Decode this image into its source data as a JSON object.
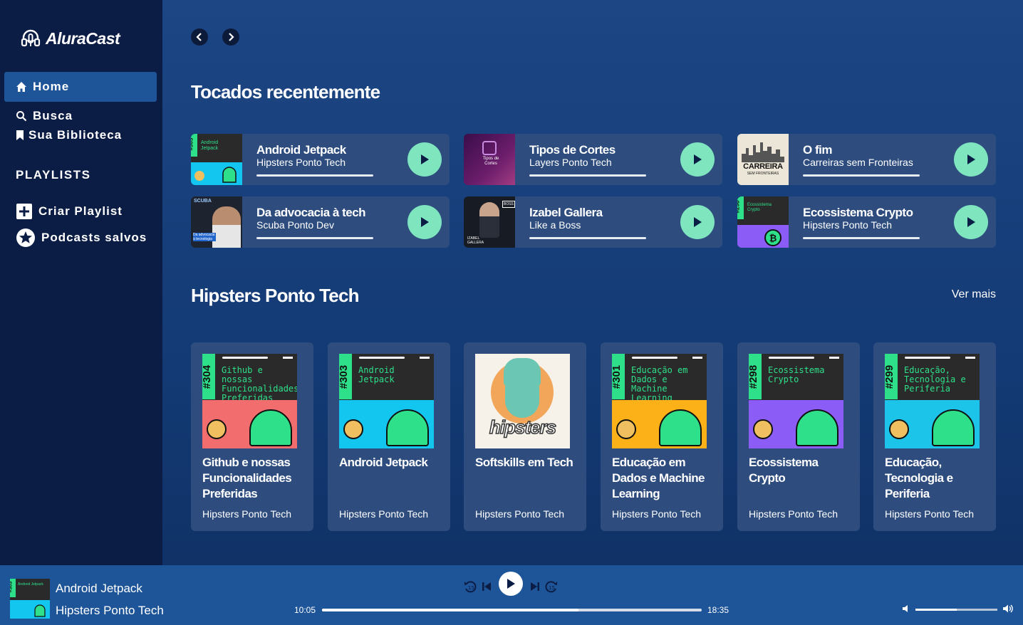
{
  "app": {
    "brand": "AluraCast"
  },
  "sidebar": {
    "nav": [
      {
        "label": "Home",
        "icon": "home-icon"
      },
      {
        "label": "Busca",
        "icon": "search-icon"
      },
      {
        "label": "Sua Biblioteca",
        "icon": "bookmark-icon"
      }
    ],
    "playlists_title": "PLAYLISTS",
    "playlist_items": [
      {
        "label": "Criar Playlist",
        "icon": "plus-square-icon"
      },
      {
        "label": "Podcasts salvos",
        "icon": "star-circle-icon"
      }
    ]
  },
  "recent": {
    "title": "Tocados recentemente",
    "items": [
      {
        "title": "Android Jetpack",
        "podcast": "Hipsters Ponto Tech",
        "cover_text": "Android Jetpack",
        "cover_num": "#303"
      },
      {
        "title": "Tipos de Cortes",
        "podcast": "Layers Ponto Tech",
        "cover_text": "Tipos de Cortes",
        "cover_num": ""
      },
      {
        "title": "O fim",
        "podcast": "Carreiras sem Fronteiras",
        "cover_text": "CARREIRA",
        "cover_num": "SEM FRONTEIRAS"
      },
      {
        "title": "Da advocacia à tech",
        "podcast": "Scuba Ponto Dev",
        "cover_text": "SCUBA",
        "cover_num": "Da advocacia à tecnologia"
      },
      {
        "title": "Izabel Gallera",
        "podcast": "Like a Boss",
        "cover_text": "IZABEL GALLERA",
        "cover_num": "BOSS"
      },
      {
        "title": "Ecossistema Crypto",
        "podcast": "Hipsters Ponto Tech",
        "cover_text": "Ecossistema Crypto",
        "cover_num": "#298"
      }
    ]
  },
  "hipsters": {
    "title": "Hipsters Ponto Tech",
    "see_more": "Ver mais",
    "episodes": [
      {
        "title": "Github e nossas Funcionalidades Preferidas",
        "podcast": "Hipsters Ponto Tech",
        "num": "#304",
        "cover_text": "Github e nossas Funcionalidades Preferidas",
        "accent": "#f26d6d"
      },
      {
        "title": "Android Jetpack",
        "podcast": "Hipsters Ponto Tech",
        "num": "#303",
        "cover_text": "Android Jetpack",
        "accent": "#13c6f0"
      },
      {
        "title": "Softskills em Tech",
        "podcast": "Hipsters Ponto Tech",
        "num": "",
        "cover_text": "hipsters",
        "accent": "#f6f2ea"
      },
      {
        "title": "Educação em Dados e Machine Learning",
        "podcast": "Hipsters Ponto Tech",
        "num": "#301",
        "cover_text": "Educação em Dados e Machine Learning",
        "accent": "#fbb117"
      },
      {
        "title": "Ecossistema Crypto",
        "podcast": "Hipsters Ponto Tech",
        "num": "#298",
        "cover_text": "Ecossistema Crypto",
        "accent": "#8b5cf6"
      },
      {
        "title": "Educação, Tecnologia e Periferia",
        "podcast": "Hipsters Ponto Tech",
        "num": "#299",
        "cover_text": "Educação, Tecnologia e Periferia",
        "accent": "#1cc4ea"
      }
    ]
  },
  "player": {
    "title": "Android Jetpack",
    "podcast": "Hipsters Ponto Tech",
    "elapsed": "10:05",
    "duration": "18:35",
    "progress": 0.676,
    "volume": 0.5,
    "cover_num": "#303",
    "cover_text": "Android Jetpack"
  },
  "colors": {
    "sidebar_bg": "#0c1d45",
    "card_bg": "#2e4d7e",
    "accent_green": "#7ee5bf",
    "player_bg": "#1e5498",
    "active_nav": "#1e5498",
    "cover_green": "#2ee08a"
  }
}
